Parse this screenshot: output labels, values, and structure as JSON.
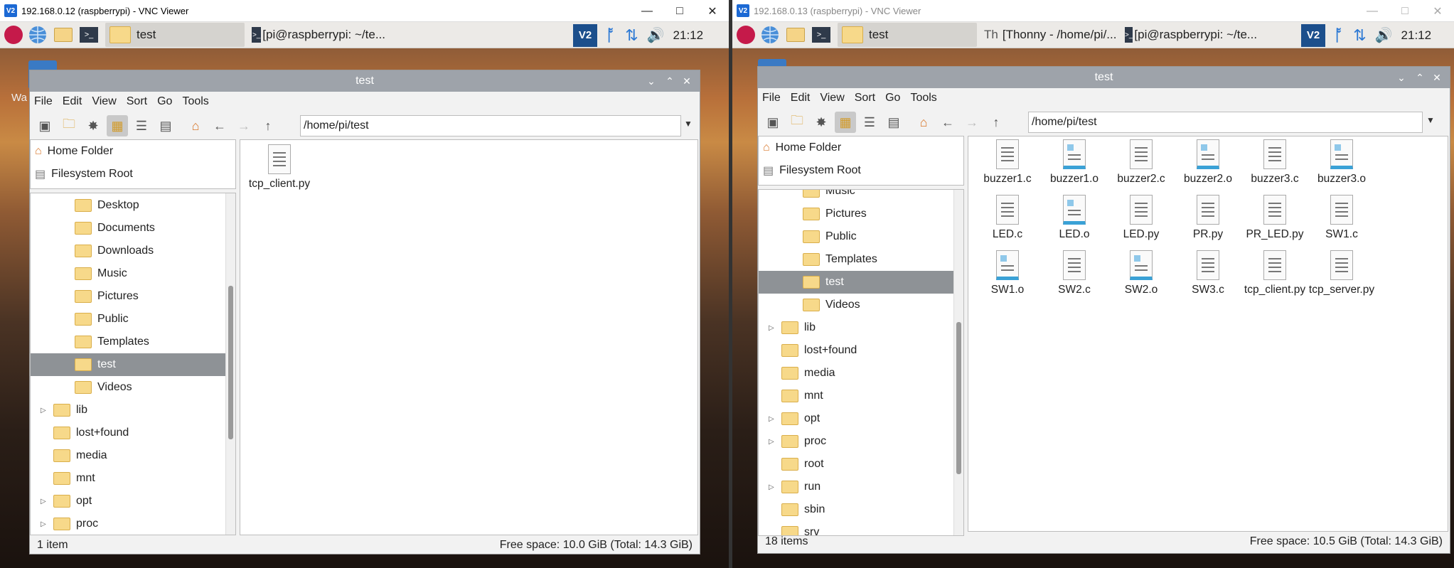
{
  "left": {
    "vnc_title": "192.168.0.12 (raspberrypi) - VNC Viewer",
    "tasks": [
      {
        "label": "test",
        "active": true
      },
      {
        "label": "[pi@raspberrypi: ~/te...",
        "active": false
      }
    ],
    "clock": "21:12",
    "fm": {
      "title": "test",
      "menu": [
        "File",
        "Edit",
        "View",
        "Sort",
        "Go",
        "Tools"
      ],
      "path": "/home/pi/test",
      "places": [
        "Home Folder",
        "Filesystem Root"
      ],
      "tree": [
        "Desktop",
        "Documents",
        "Downloads",
        "Music",
        "Pictures",
        "Public",
        "Templates",
        "test",
        "Videos",
        "lib",
        "lost+found",
        "media",
        "mnt",
        "opt",
        "proc"
      ],
      "files": [
        "tcp_client.py"
      ],
      "status_left": "1 item",
      "status_right": "Free space: 10.0 GiB (Total: 14.3 GiB)"
    },
    "desktop_text": "Wa"
  },
  "right": {
    "vnc_title": "192.168.0.13 (raspberrypi) - VNC Viewer",
    "tasks": [
      {
        "label": "test",
        "active": true
      },
      {
        "label": "[Thonny  -  /home/pi/...",
        "active": false
      },
      {
        "label": "[pi@raspberrypi: ~/te...",
        "active": false
      }
    ],
    "clock": "21:12",
    "fm": {
      "title": "test",
      "menu": [
        "File",
        "Edit",
        "View",
        "Sort",
        "Go",
        "Tools"
      ],
      "path": "/home/pi/test",
      "places": [
        "Home Folder",
        "Filesystem Root"
      ],
      "tree": [
        "Music",
        "Pictures",
        "Public",
        "Templates",
        "test",
        "Videos",
        "lib",
        "lost+found",
        "media",
        "mnt",
        "opt",
        "proc",
        "root",
        "run",
        "sbin",
        "srv"
      ],
      "files": [
        "buzzer1.c",
        "buzzer1.o",
        "buzzer2.c",
        "buzzer2.o",
        "buzzer3.c",
        "buzzer3.o",
        "LED.c",
        "LED.o",
        "LED.py",
        "PR.py",
        "PR_LED.py",
        "SW1.c",
        "SW1.o",
        "SW2.c",
        "SW2.o",
        "SW3.c",
        "tcp_client.py",
        "tcp_server.py"
      ],
      "status_left": "18 items",
      "status_right": "Free space: 10.5 GiB (Total: 14.3 GiB)"
    }
  },
  "icons": {
    "raspberry": "raspberry-icon",
    "globe": "globe-icon",
    "folders": "folders-icon",
    "terminal": "terminal-icon",
    "vnc": "vnc-icon",
    "bluetooth": "bluetooth-icon",
    "network": "network-arrows-icon",
    "volume": "volume-icon"
  }
}
